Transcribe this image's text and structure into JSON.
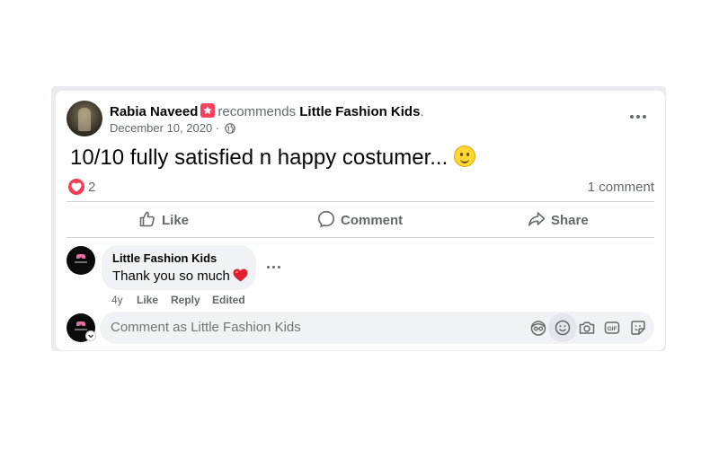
{
  "post": {
    "author_name": "Rabia Naveed",
    "recommends_text": "recommends",
    "page_name": "Little Fashion Kids",
    "page_name_suffix": ".",
    "date": "December 10, 2020",
    "date_separator": " · ",
    "privacy_icon": "globe-icon",
    "text": "10/10 fully satisfied n happy costumer...",
    "text_emoji": "slightly-smiling-face",
    "reaction_type": "love",
    "reaction_count": "2",
    "comment_count": "1 comment"
  },
  "actions": {
    "like_label": "Like",
    "comment_label": "Comment",
    "share_label": "Share"
  },
  "comment": {
    "author": "Little Fashion Kids",
    "text": "Thank you so much",
    "text_emoji": "red-heart",
    "age": "4y",
    "like_label": "Like",
    "reply_label": "Reply",
    "edited_label": "Edited"
  },
  "composer": {
    "placeholder": "Comment as Little Fashion Kids",
    "tools": [
      "avatar-sticker-icon",
      "emoji-icon",
      "camera-icon",
      "gif-icon",
      "sticker-icon"
    ]
  },
  "colors": {
    "recommend_badge": "#f3425f",
    "love_reaction": "#f33e58",
    "secondary_text": "#65676b",
    "bubble_bg": "#f0f2f5"
  }
}
